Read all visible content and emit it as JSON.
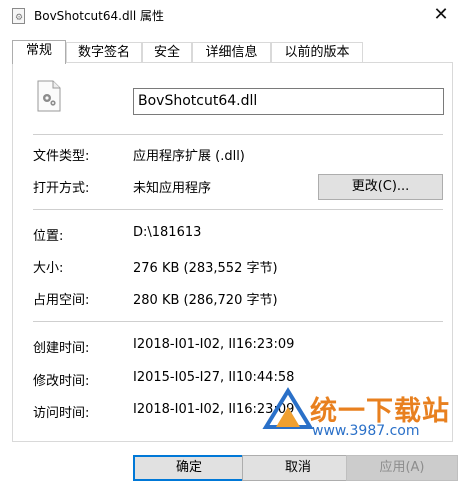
{
  "window": {
    "title": "BovShotcut64.dll 属性",
    "close_glyph": "✕",
    "file_icon": "gear-icon"
  },
  "tabs": [
    {
      "label": "常规",
      "active": true
    },
    {
      "label": "数字签名",
      "active": false
    },
    {
      "label": "安全",
      "active": false
    },
    {
      "label": "详细信息",
      "active": false
    },
    {
      "label": "以前的版本",
      "active": false
    }
  ],
  "general": {
    "file_name": "BovShotcut64.dll",
    "file_type_label": "文件类型:",
    "file_type_value": "应用程序扩展 (.dll)",
    "open_with_label": "打开方式:",
    "open_with_value": "未知应用程序",
    "change_button": "更改(C)...",
    "location_label": "位置:",
    "location_value": "D:\\181613",
    "size_label": "大小:",
    "size_value": "276 KB (283,552 字节)",
    "disk_size_label": "占用空间:",
    "disk_size_value": "280 KB (286,720 字节)",
    "created_label": "创建时间:",
    "created_value": "I2018-I01-I02, II16:23:09",
    "modified_label": "修改时间:",
    "modified_value": "I2015-I05-I27, II10:44:58",
    "accessed_label": "访问时间:",
    "accessed_value": "I2018-I01-I02, II16:23:09"
  },
  "footer": {
    "ok": "确定",
    "cancel": "取消",
    "apply": "应用(A)"
  },
  "watermark": {
    "text": "统一下载站",
    "url": "www.3987.com"
  }
}
